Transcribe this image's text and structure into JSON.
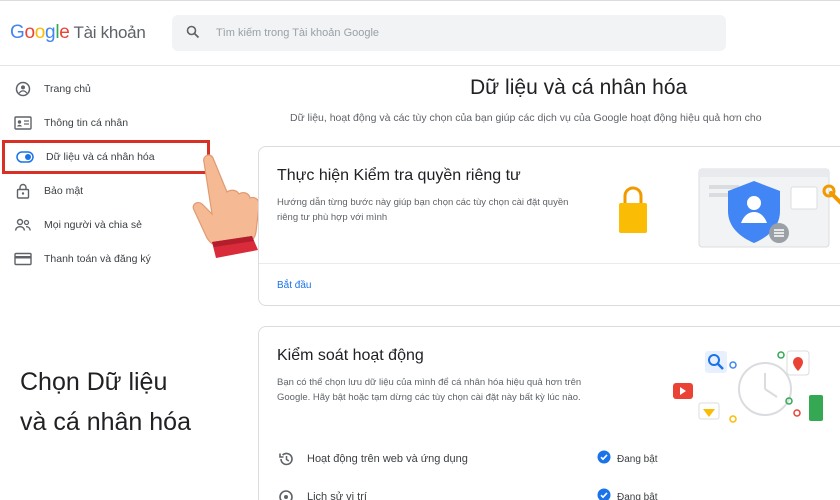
{
  "header": {
    "logo_google": "Google",
    "logo_account": "Tài khoản",
    "search_placeholder": "Tìm kiếm trong Tài khoản Google",
    "search_icon": "search-icon"
  },
  "sidebar": {
    "items": [
      {
        "label": "Trang chủ",
        "icon": "home-icon"
      },
      {
        "label": "Thông tin cá nhân",
        "icon": "id-card-icon"
      },
      {
        "label": "Dữ liệu và cá nhân hóa",
        "icon": "toggle-icon",
        "active": true
      },
      {
        "label": "Bảo mật",
        "icon": "lock-icon"
      },
      {
        "label": "Mọi người và chia sẻ",
        "icon": "people-icon"
      },
      {
        "label": "Thanh toán và đăng ký",
        "icon": "payment-icon"
      }
    ]
  },
  "annotation": {
    "line1": "Chọn Dữ liệu",
    "line2": "và cá nhân hóa",
    "highlight_color": "#d93025"
  },
  "main": {
    "title": "Dữ liệu và cá nhân hóa",
    "subtitle": "Dữ liệu, hoạt động và các tùy chọn của bạn giúp các dịch vụ của Google hoạt động hiệu quả hơn cho",
    "privacy_card": {
      "title": "Thực hiện Kiểm tra quyền riêng tư",
      "desc_line1": "Hướng dẫn từng bước này giúp bạn chọn các tùy chọn cài đặt quyền",
      "desc_line2": "riêng tư phù hợp với mình",
      "link": "Bắt đầu"
    },
    "activity_card": {
      "title": "Kiểm soát hoạt động",
      "desc_line1": "Bạn có thể chọn lưu dữ liệu của mình để cá nhân hóa hiệu quả hơn trên",
      "desc_line2": "Google. Hãy bật hoặc tạm dừng các tùy chọn cài đặt này bất kỳ lúc nào.",
      "rows": [
        {
          "label": "Hoạt động trên web và ứng dụng",
          "status": "Đang bật",
          "icon": "history-icon"
        },
        {
          "label": "Lịch sử vị trí",
          "status": "Đang bật",
          "icon": "location-icon"
        }
      ]
    }
  },
  "colors": {
    "accent": "#1a73e8",
    "google_blue": "#4285f4",
    "google_red": "#ea4335",
    "google_yellow": "#fbbc05",
    "google_green": "#34a853"
  }
}
